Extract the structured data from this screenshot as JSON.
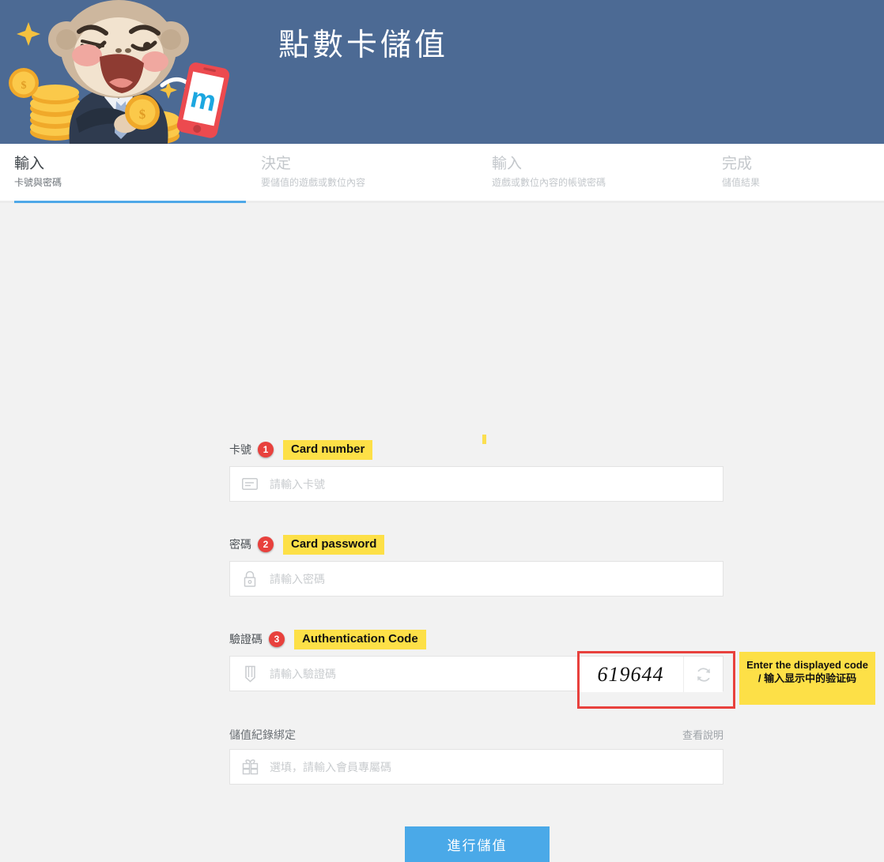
{
  "banner": {
    "title": "點數卡儲值",
    "bg_color": "#4c6a94",
    "mascot_name": "monkey-mascot-with-coins"
  },
  "steps": [
    {
      "title": "輸入",
      "sub": "卡號與密碼",
      "active": true
    },
    {
      "title": "決定",
      "sub": "要儲值的遊戲或數位內容",
      "active": false
    },
    {
      "title": "輸入",
      "sub": "遊戲或數位內容的帳號密碼",
      "active": false
    },
    {
      "title": "完成",
      "sub": "儲值結果",
      "active": false
    }
  ],
  "form": {
    "card_number": {
      "label": "卡號",
      "badge": "1",
      "highlight": "Card number",
      "placeholder": "請輸入卡號",
      "value": "",
      "icon": "card-icon"
    },
    "card_password": {
      "label": "密碼",
      "badge": "2",
      "highlight": "Card password",
      "placeholder": "請輸入密碼",
      "value": "",
      "icon": "lock-icon"
    },
    "auth_code": {
      "label": "驗證碼",
      "badge": "3",
      "highlight": "Authentication Code",
      "placeholder": "請輸入驗證碼",
      "value": "",
      "icon": "pencil-icon",
      "captcha_text": "619644",
      "refresh_icon": "refresh-icon",
      "tooltip": "Enter the displayed code / 输入显示中的验证码"
    },
    "binding": {
      "label": "儲值紀錄綁定",
      "link": "查看說明",
      "placeholder": "選填，請輸入會員專屬碼",
      "value": "",
      "icon": "gift-icon"
    },
    "submit_label": "進行儲值"
  },
  "colors": {
    "header_blue": "#4c6a94",
    "accent_blue": "#4aa9e8",
    "badge_red": "#e8413d",
    "highlight_yellow": "#fde047",
    "page_bg": "#f2f2f2"
  }
}
